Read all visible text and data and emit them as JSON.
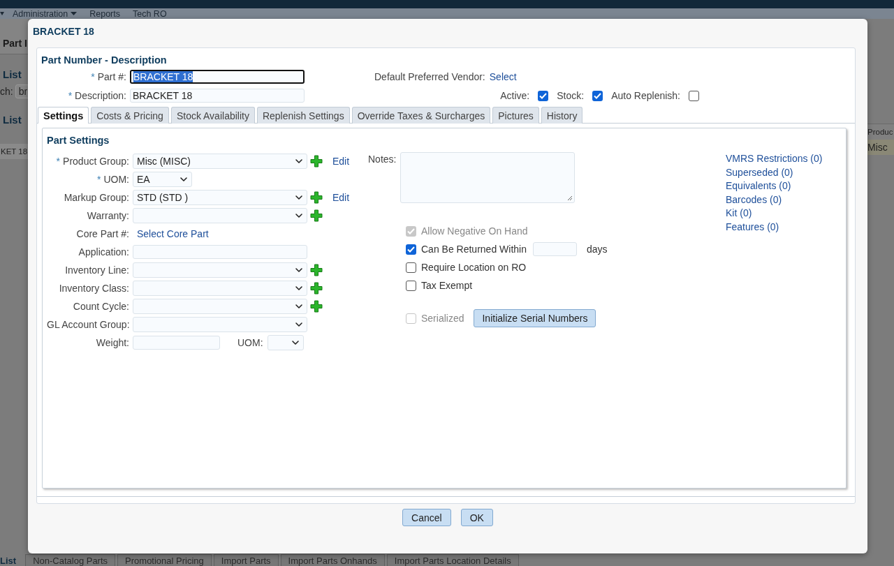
{
  "background": {
    "nav_items": [
      {
        "label": "Administration",
        "dropdown": true
      },
      {
        "label": "Reports",
        "dropdown": false
      },
      {
        "label": "Tech RO",
        "dropdown": false
      }
    ],
    "left": {
      "page_title": "Part I",
      "list_heading": "List",
      "search_label": "ch:",
      "search_value": "br",
      "results_heading": "List",
      "row_cell": "KET 18"
    },
    "right": {
      "column_header": "Produc",
      "cell": "Misc"
    },
    "bottom_tabs": [
      {
        "label": "List",
        "selected": true
      },
      {
        "label": "Non-Catalog Parts",
        "selected": false
      },
      {
        "label": "Promotional Pricing",
        "selected": false
      },
      {
        "label": "Import Parts",
        "selected": false
      },
      {
        "label": "Import Parts Onhands",
        "selected": false
      },
      {
        "label": "Import Parts Location Details",
        "selected": false
      }
    ]
  },
  "dialog": {
    "title": "BRACKET 18",
    "header": "Part Number - Description",
    "part_number": {
      "required_mark": "*",
      "label": "Part #:",
      "value": "BRACKET 18",
      "focused": true
    },
    "description": {
      "required_mark": "*",
      "label": "Description:",
      "value": "BRACKET 18",
      "focused": false
    },
    "vendor": {
      "label": "Default Preferred Vendor:",
      "link": "Select"
    },
    "flags": [
      {
        "label": "Active:",
        "checked": true
      },
      {
        "label": "Stock:",
        "checked": true
      },
      {
        "label": "Auto Replenish:",
        "checked": false
      }
    ],
    "tabs": [
      {
        "label": "Settings",
        "selected": true
      },
      {
        "label": "Costs & Pricing",
        "selected": false
      },
      {
        "label": "Stock Availability",
        "selected": false
      },
      {
        "label": "Replenish Settings",
        "selected": false
      },
      {
        "label": "Override Taxes & Surcharges",
        "selected": false
      },
      {
        "label": "Pictures",
        "selected": false
      },
      {
        "label": "History",
        "selected": false
      }
    ],
    "section_title": "Part Settings",
    "fields": [
      {
        "kind": "select",
        "required_mark": "*",
        "label": "Product Group:",
        "value": "Misc (MISC)",
        "add_button": true,
        "edit_link": "Edit"
      },
      {
        "kind": "short_select",
        "required_mark": "*",
        "label": "UOM:",
        "value": "EA"
      },
      {
        "kind": "select",
        "label": "Markup Group:",
        "value": "STD (STD )",
        "add_button": true,
        "edit_link": "Edit"
      },
      {
        "kind": "select",
        "label": "Warranty:",
        "add_button": true
      },
      {
        "kind": "link",
        "label": "Core Part #:",
        "link": "Select Core Part"
      },
      {
        "kind": "input",
        "label": "Application:"
      },
      {
        "kind": "select",
        "label": "Inventory Line:",
        "add_button": true
      },
      {
        "kind": "select",
        "label": "Inventory Class:",
        "add_button": true
      },
      {
        "kind": "select",
        "label": "Count Cycle:",
        "add_button": true
      },
      {
        "kind": "select",
        "label": "GL Account Group:",
        "add_button": false
      },
      {
        "kind": "weight",
        "label": "Weight:",
        "unit_label": "UOM:"
      }
    ],
    "notes_label": "Notes:",
    "options": [
      {
        "label": "Allow Negative On Hand",
        "checked": true,
        "disabled": true
      },
      {
        "label": "Can Be Returned Within",
        "checked": true,
        "disabled": false,
        "suffix": "days"
      },
      {
        "label": "Require Location on RO",
        "checked": false,
        "disabled": false
      },
      {
        "label": "Tax Exempt",
        "checked": false,
        "disabled": false
      }
    ],
    "serialized": {
      "label": "Serialized",
      "checked": false,
      "disabled": true,
      "button": "Initialize Serial Numbers"
    },
    "links": [
      "VMRS Restrictions (0)",
      "Superseded (0)",
      "Equivalents (0)",
      "Barcodes (0)",
      "Kit (0)",
      "Features (0)"
    ],
    "buttons": [
      "Cancel",
      "OK"
    ]
  }
}
